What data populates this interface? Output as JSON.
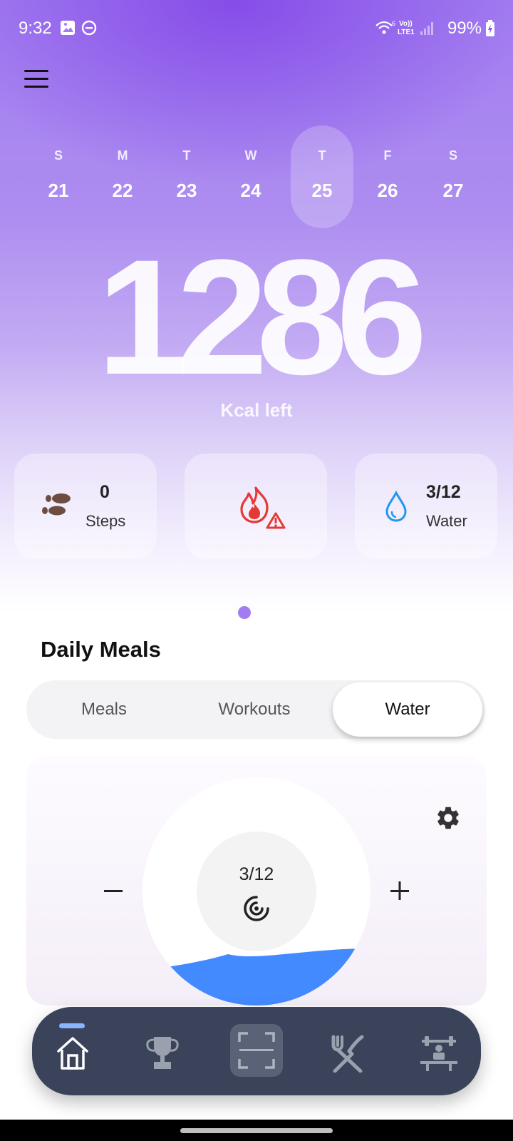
{
  "status_bar": {
    "time": "9:32",
    "battery": "99%"
  },
  "week": {
    "days": [
      {
        "dow": "S",
        "date": "21"
      },
      {
        "dow": "M",
        "date": "22"
      },
      {
        "dow": "T",
        "date": "23"
      },
      {
        "dow": "W",
        "date": "24"
      },
      {
        "dow": "T",
        "date": "25"
      },
      {
        "dow": "F",
        "date": "26"
      },
      {
        "dow": "S",
        "date": "27"
      }
    ],
    "selected_index": 4
  },
  "summary": {
    "kcal_left": "1286",
    "kcal_label": "Kcal left"
  },
  "cards": {
    "steps": {
      "value": "0",
      "label": "Steps"
    },
    "water": {
      "value": "3/12",
      "label": "Water"
    }
  },
  "section": {
    "title": "Daily Meals"
  },
  "tabs": {
    "items": [
      "Meals",
      "Workouts",
      "Water"
    ],
    "active": "Water"
  },
  "water_tracker": {
    "count_text": "3/12",
    "fill_fraction": 0.25,
    "fill_color": "#448aff"
  },
  "bottom_nav": {
    "items": [
      "home-icon",
      "trophy-icon",
      "scan-icon",
      "fork-knife-icon",
      "weights-icon"
    ],
    "active": "home-icon"
  },
  "colors": {
    "accent": "#a27df0",
    "nav_bg": "#3a4359",
    "flame": "#e53935"
  }
}
